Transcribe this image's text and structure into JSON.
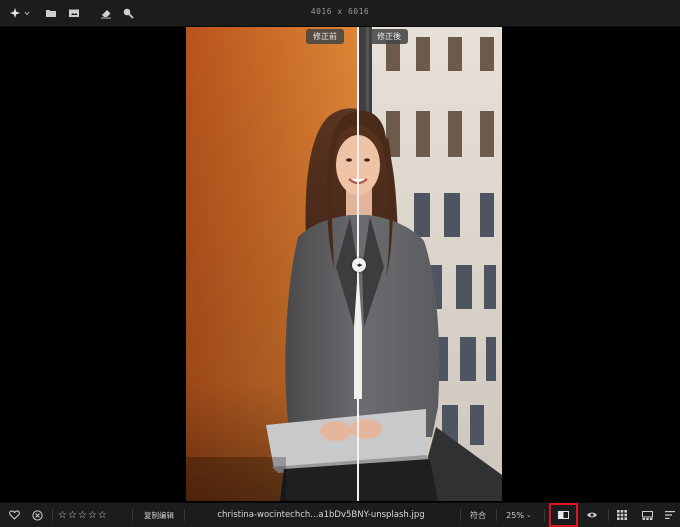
{
  "toolbar": {
    "dimensions": "4016 x 6016",
    "icons": [
      "magic-wand-icon",
      "folder-icon",
      "photo-import-icon",
      "eraser-icon",
      "magnifier-icon"
    ]
  },
  "viewer": {
    "before_label": "修正前",
    "after_label": "修正後",
    "split_handle": "◂▸"
  },
  "footer": {
    "copy_edit_label": "复制编辑",
    "filename": "christina-wocintechch...a1bDv5BNY-unsplash.jpg",
    "fit_label": "符合",
    "zoom_value": "25%",
    "zoom_caret": "⌄",
    "rating": 0,
    "stars": [
      "☆",
      "☆",
      "☆",
      "☆",
      "☆"
    ],
    "highlight_color": "#e0141e"
  }
}
